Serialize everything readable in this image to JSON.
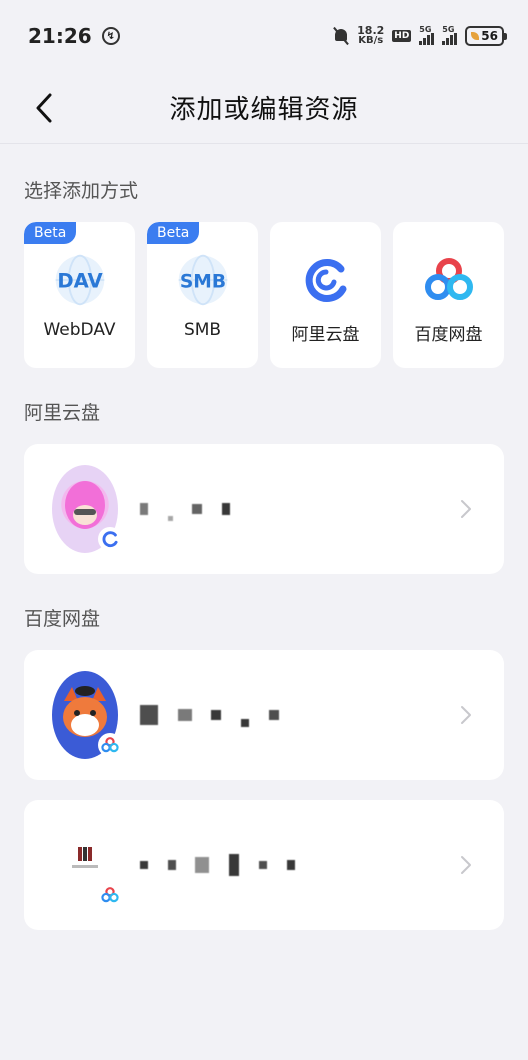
{
  "status_bar": {
    "time": "21:26",
    "net_speed_value": "18.2",
    "net_speed_unit": "KB/s",
    "hd_label": "HD",
    "signal1_label": "5G",
    "signal2_label": "5G",
    "battery_level": "56"
  },
  "header": {
    "title": "添加或编辑资源"
  },
  "add_section": {
    "title": "选择添加方式",
    "sources": [
      {
        "label": "WebDAV",
        "badge": "Beta",
        "icon": "dav-icon"
      },
      {
        "label": "SMB",
        "badge": "Beta",
        "icon": "smb-icon"
      },
      {
        "label": "阿里云盘",
        "badge": "",
        "icon": "aliyun-drive-icon"
      },
      {
        "label": "百度网盘",
        "badge": "",
        "icon": "baidu-netdisk-icon"
      }
    ],
    "dav_icon_text": "DAV",
    "smb_icon_text": "SMB"
  },
  "aliyun_section": {
    "title": "阿里云盘"
  },
  "baidu_section": {
    "title": "百度网盘"
  },
  "colors": {
    "accent": "#3b7df0",
    "background": "#f2f2f6",
    "card": "#ffffff"
  }
}
